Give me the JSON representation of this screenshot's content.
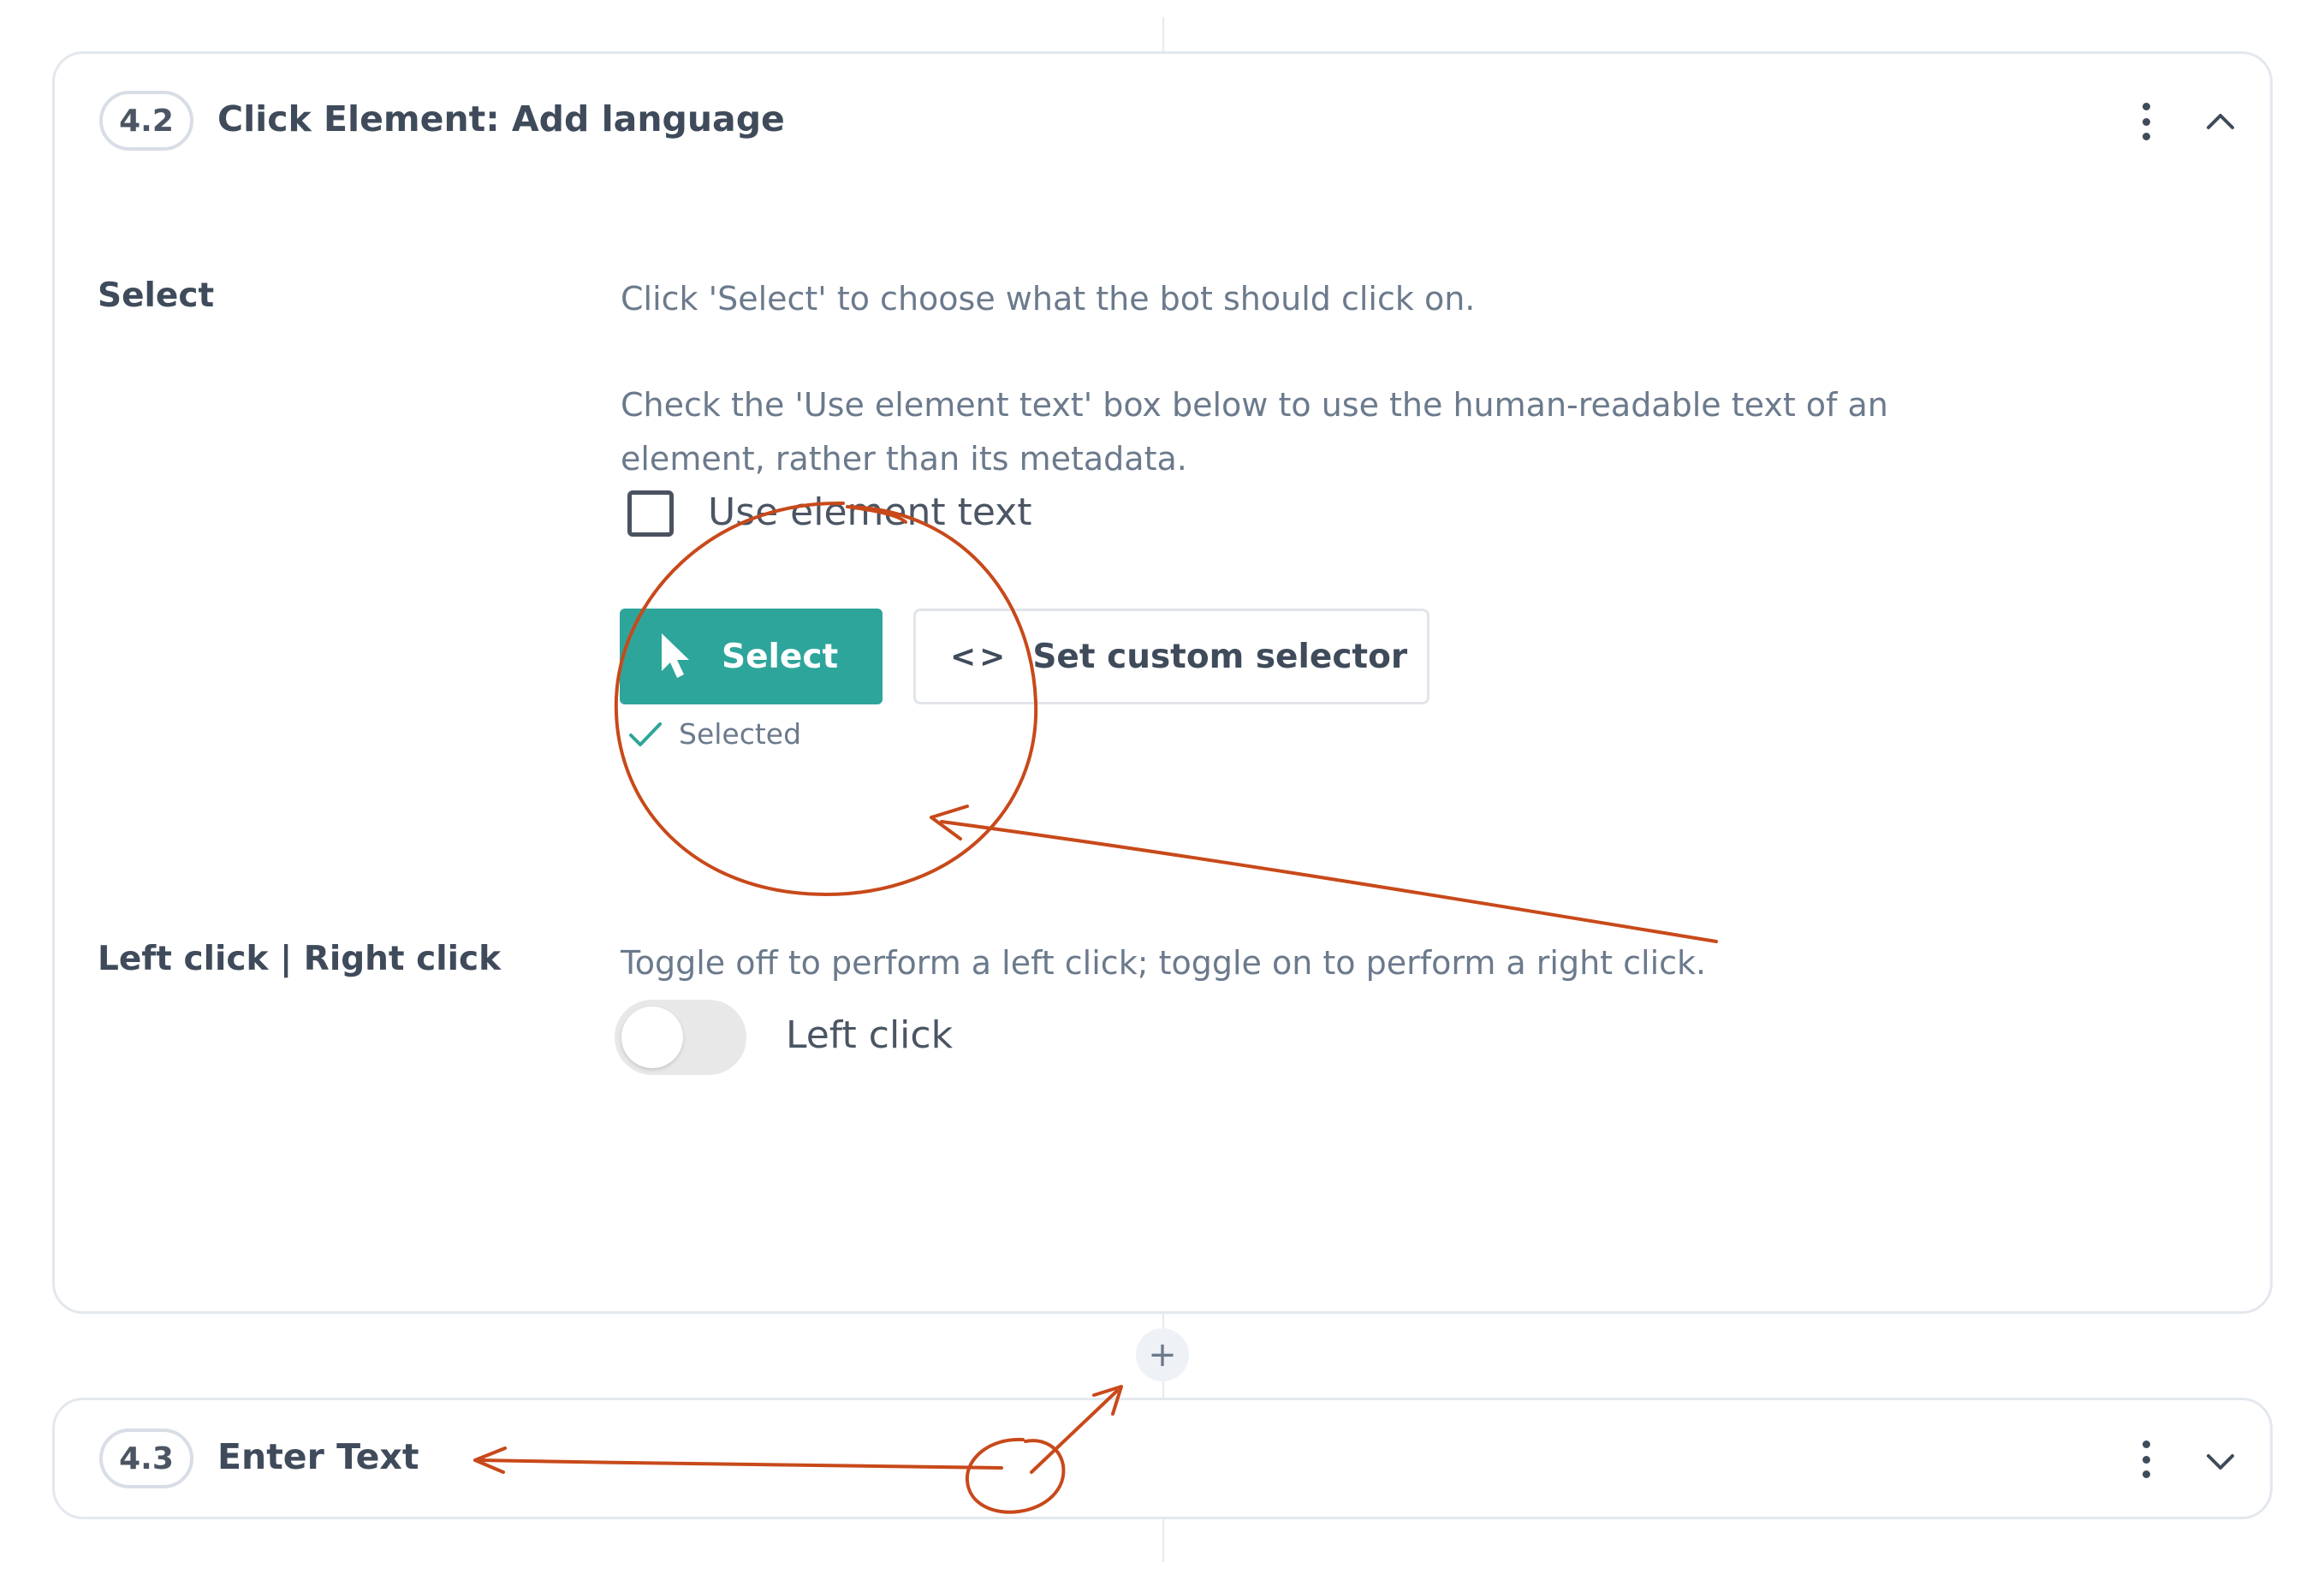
{
  "colors": {
    "accent": "#2ea59a",
    "annotation": "#c8491a",
    "card_border": "#e3e8ee",
    "text": "#3f4b5b",
    "muted": "#6b7a8c"
  },
  "steps": [
    {
      "number": "4.2",
      "title": "Click Element: Add language",
      "expanded": true,
      "more_icon": "kebab-menu-icon",
      "toggle_icon": "chevron-up-icon"
    },
    {
      "number": "4.3",
      "title": "Enter Text",
      "expanded": false,
      "more_icon": "kebab-menu-icon",
      "toggle_icon": "chevron-down-icon"
    }
  ],
  "select_section": {
    "label": "Select",
    "description_1": "Click 'Select' to choose what the bot should click on.",
    "description_2_line_1": "Check the 'Use element text' box below to use the human-readable text of an",
    "description_2_line_2": "element, rather than its metadata.",
    "use_element_text_label": "Use element text",
    "use_element_text_checked": false,
    "select_button_label": "Select",
    "select_button_icon": "cursor-pointer-icon",
    "custom_selector_label": "Set custom selector",
    "custom_selector_icon": "code-icon",
    "custom_selector_glyph": "<>",
    "status_icon": "checkmark-icon",
    "status_text": "Selected"
  },
  "click_section": {
    "label": "Left click | Right click",
    "description": "Toggle off to perform a left click; toggle on to perform a right click.",
    "toggle_on": false,
    "toggle_label": "Left click"
  },
  "add_step_glyph": "+"
}
